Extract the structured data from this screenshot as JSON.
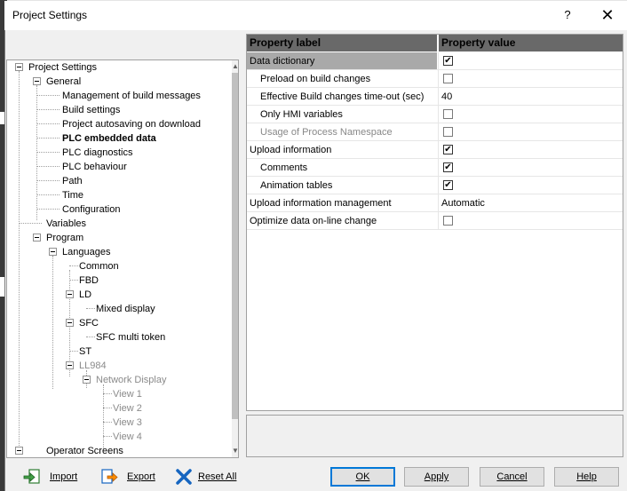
{
  "window": {
    "title": "Project Settings",
    "help": "?",
    "close": "✕"
  },
  "tree": {
    "nodes": [
      "Project Settings",
      "General",
      "Management of build messages",
      "Build settings",
      "Project autosaving on download",
      "PLC embedded data",
      "PLC diagnostics",
      "PLC behaviour",
      "Path",
      "Time",
      "Configuration",
      "Variables",
      "Program",
      "Languages",
      "Common",
      "FBD",
      "LD",
      "Mixed display",
      "SFC",
      "SFC multi token",
      "ST",
      "LL984",
      "Network Display",
      "View 1",
      "View 2",
      "View 3",
      "View 4",
      "Operator Screens"
    ]
  },
  "grid": {
    "header_label": "Property label",
    "header_value": "Property value",
    "rows": [
      {
        "label": "Data dictionary",
        "checked": true
      },
      {
        "label": "Preload on build changes",
        "checked": false
      },
      {
        "label": "Effective Build changes time-out (sec)",
        "value": "40"
      },
      {
        "label": "Only HMI variables",
        "checked": false
      },
      {
        "label": "Usage of Process Namespace",
        "checked": false
      },
      {
        "label": "Upload information",
        "checked": true
      },
      {
        "label": "Comments",
        "checked": true
      },
      {
        "label": "Animation tables",
        "checked": true
      },
      {
        "label": "Upload information management",
        "value": "Automatic"
      },
      {
        "label": "Optimize data on-line change",
        "checked": false
      }
    ]
  },
  "buttons": {
    "import": "Import",
    "export": "Export",
    "reset_all": "Reset All",
    "ok": "OK",
    "apply": "Apply",
    "cancel": "Cancel",
    "help": "Help"
  },
  "colors": {
    "accent": "#0078d7",
    "header_bg": "#696969",
    "selection": "#a9a9a9"
  }
}
